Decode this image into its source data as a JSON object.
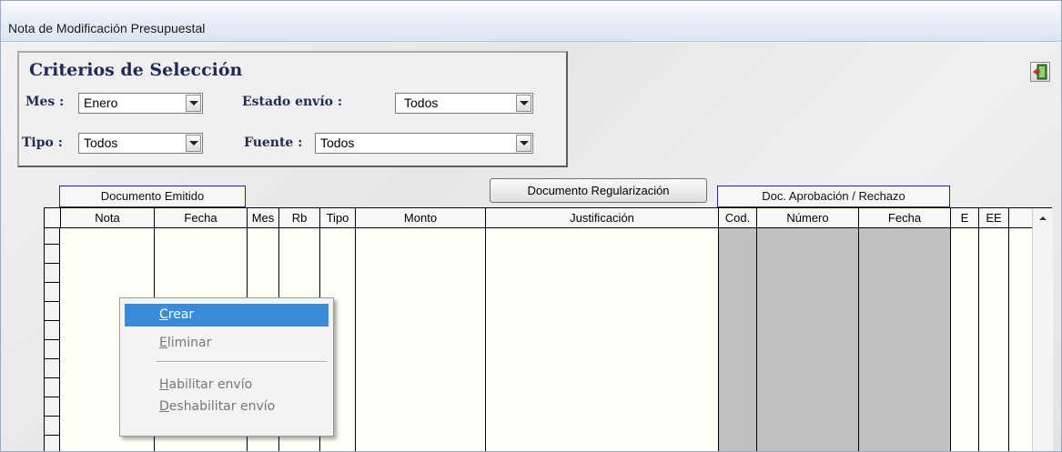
{
  "window": {
    "title": "Nota de Modificación Presupuestal"
  },
  "criteria": {
    "heading": "Criterios de Selección",
    "mes_label": "Mes :",
    "mes_value": "Enero",
    "estado_label": "Estado envío :",
    "estado_value": "Todos",
    "tipo_label": "Tipo :",
    "tipo_value": "Todos",
    "fuente_label": "Fuente :",
    "fuente_value": "Todos"
  },
  "toolbar": {
    "exit_icon": "exit-door-icon"
  },
  "groups": {
    "documento_emitido": "Documento Emitido",
    "documento_regularizacion": "Documento Regularización",
    "doc_aprobacion": "Doc. Aprobación / Rechazo"
  },
  "grid": {
    "columns": [
      "Nota",
      "Fecha",
      "Mes",
      "Rb",
      "Tipo",
      "Monto",
      "Justificación",
      "Cod.",
      "Número",
      "Fecha",
      "E",
      "EE"
    ],
    "rows": []
  },
  "context_menu": {
    "items": [
      {
        "label": "Crear",
        "mnemonic": "C",
        "rest": "rear",
        "state": "highlighted"
      },
      {
        "label": "Eliminar",
        "mnemonic": "E",
        "rest": "liminar",
        "state": "disabled"
      },
      {
        "label": "Habilitar envío",
        "mnemonic": "H",
        "rest": "abilitar envío",
        "state": "disabled"
      },
      {
        "label": "Deshabilitar envío",
        "mnemonic": "D",
        "rest": "eshabilitar envío",
        "state": "disabled"
      }
    ]
  },
  "colors": {
    "label_navy": "#1f2a55",
    "menu_highlight": "#3b8bdc",
    "approval_columns": "#c0c0c0",
    "grid_background": "#fffff8"
  }
}
